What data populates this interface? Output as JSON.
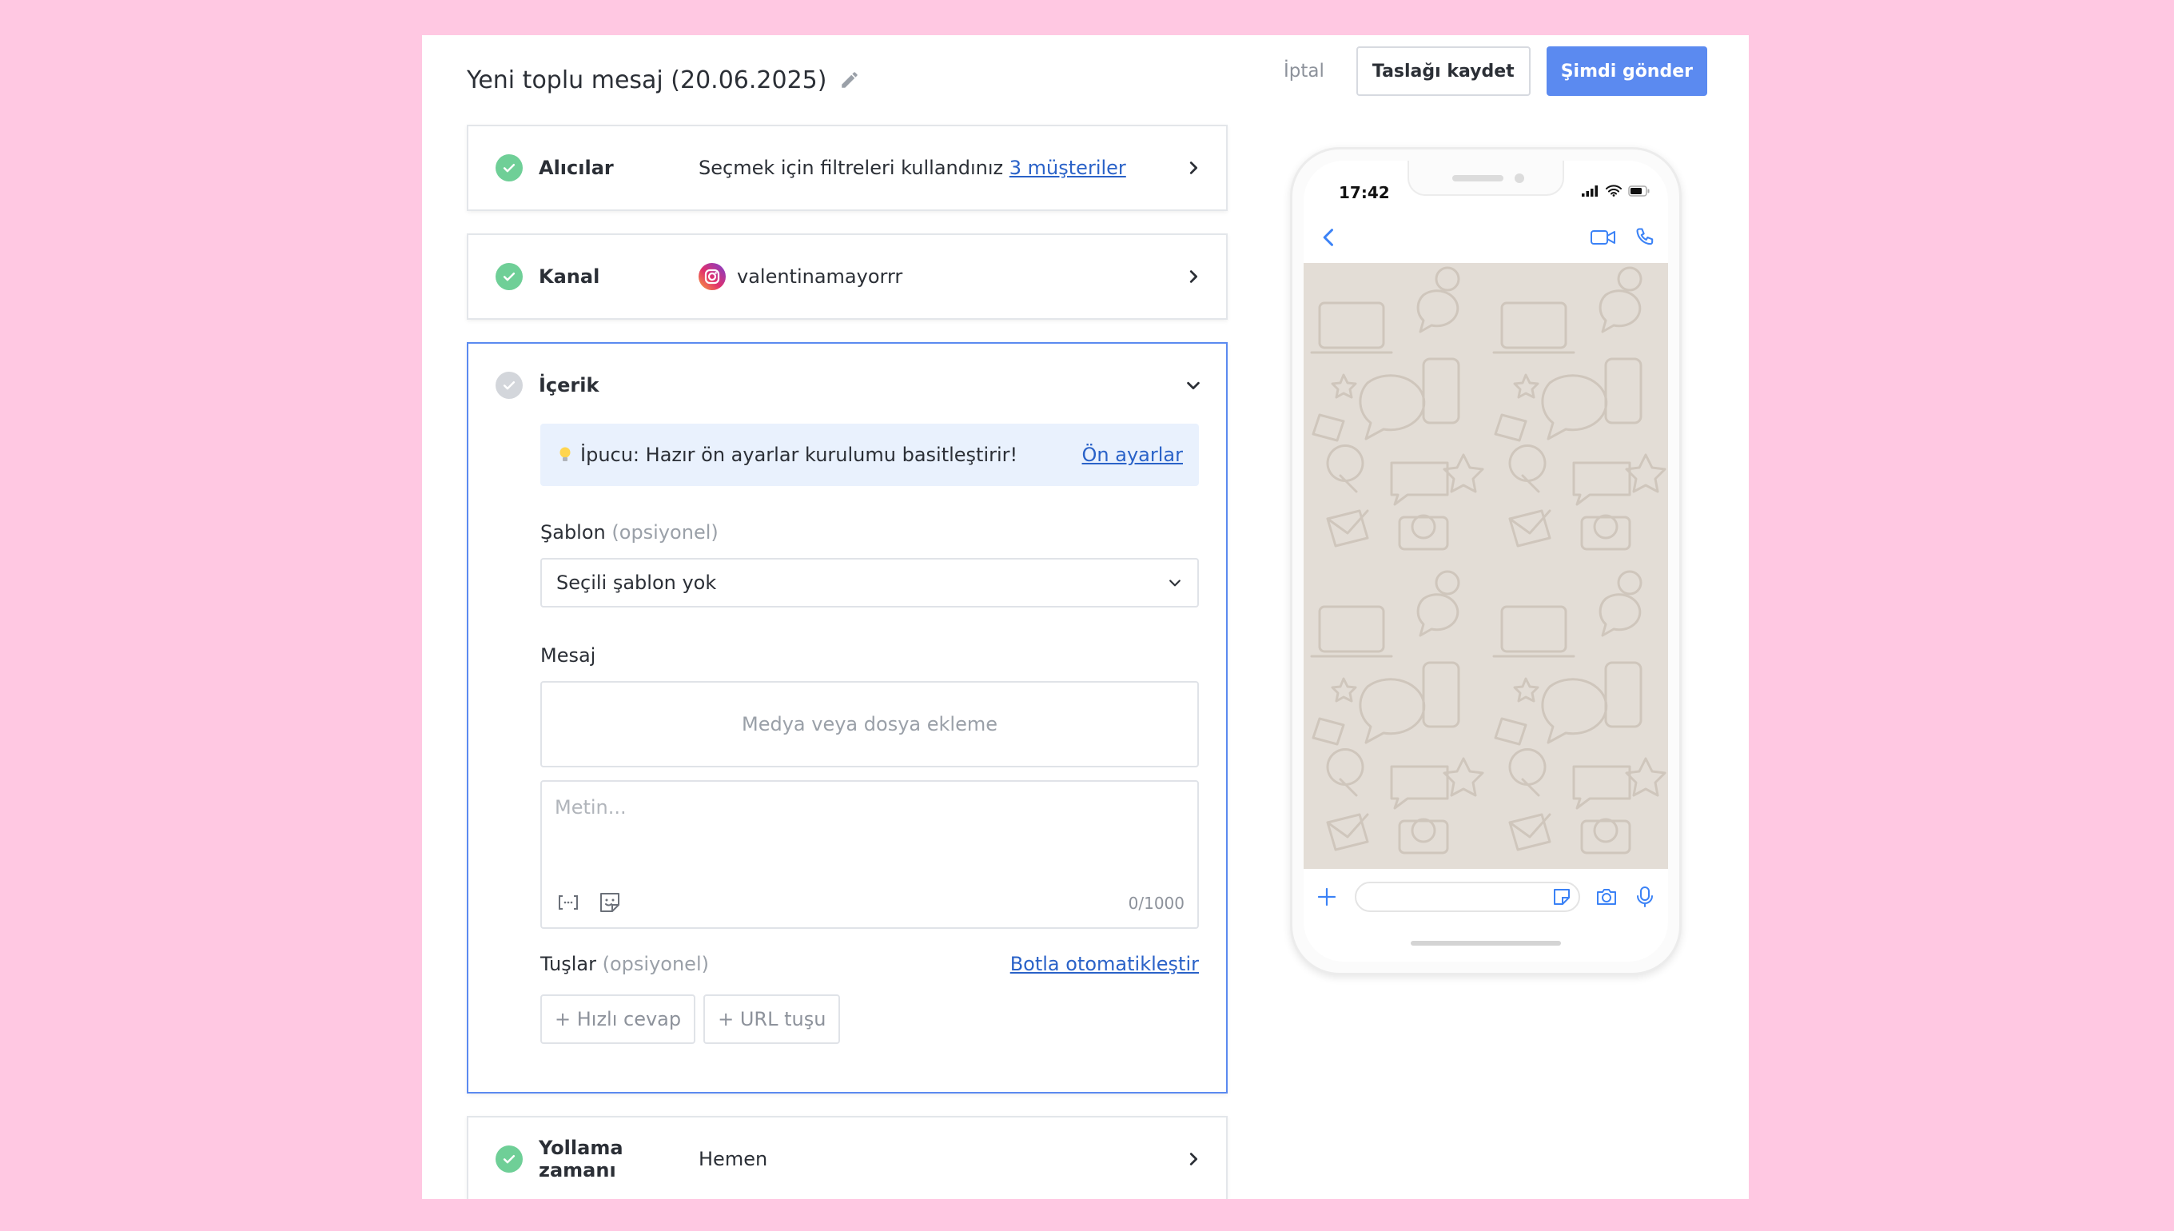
{
  "header": {
    "title": "Yeni toplu mesaj (20.06.2025)",
    "cancel_label": "İptal",
    "draft_label": "Taslağı kaydet",
    "send_label": "Şimdi gönder"
  },
  "recipients": {
    "label": "Alıcılar",
    "text": "Seçmek için filtreleri kullandınız",
    "link": "3 müşteriler"
  },
  "channel": {
    "label": "Kanal",
    "account": "valentinamayorrr"
  },
  "content": {
    "label": "İçerik",
    "tip_text": "İpucu: Hazır ön ayarlar kurulumu basitleştirir!",
    "tip_link": "Ön ayarlar",
    "template_label": "Şablon",
    "optional": "(opsiyonel)",
    "template_value": "Seçili şablon yok",
    "message_label": "Mesaj",
    "media_label": "Medya veya dosya ekleme",
    "text_placeholder": "Metin...",
    "counter": "0/1000",
    "buttons_label": "Tuşlar",
    "bot_link": "Botla otomatikleştir",
    "quick_reply": "+ Hızlı cevap",
    "url_button": "+ URL tuşu"
  },
  "schedule": {
    "label": "Yollama zamanı",
    "value": "Hemen"
  },
  "phone": {
    "time": "17:42"
  },
  "colors": {
    "accent": "#5b8af0",
    "success": "#6fcf97",
    "link": "#2a62c8",
    "background": "#ffc8e2",
    "chat_bg": "#e3ddd6"
  }
}
